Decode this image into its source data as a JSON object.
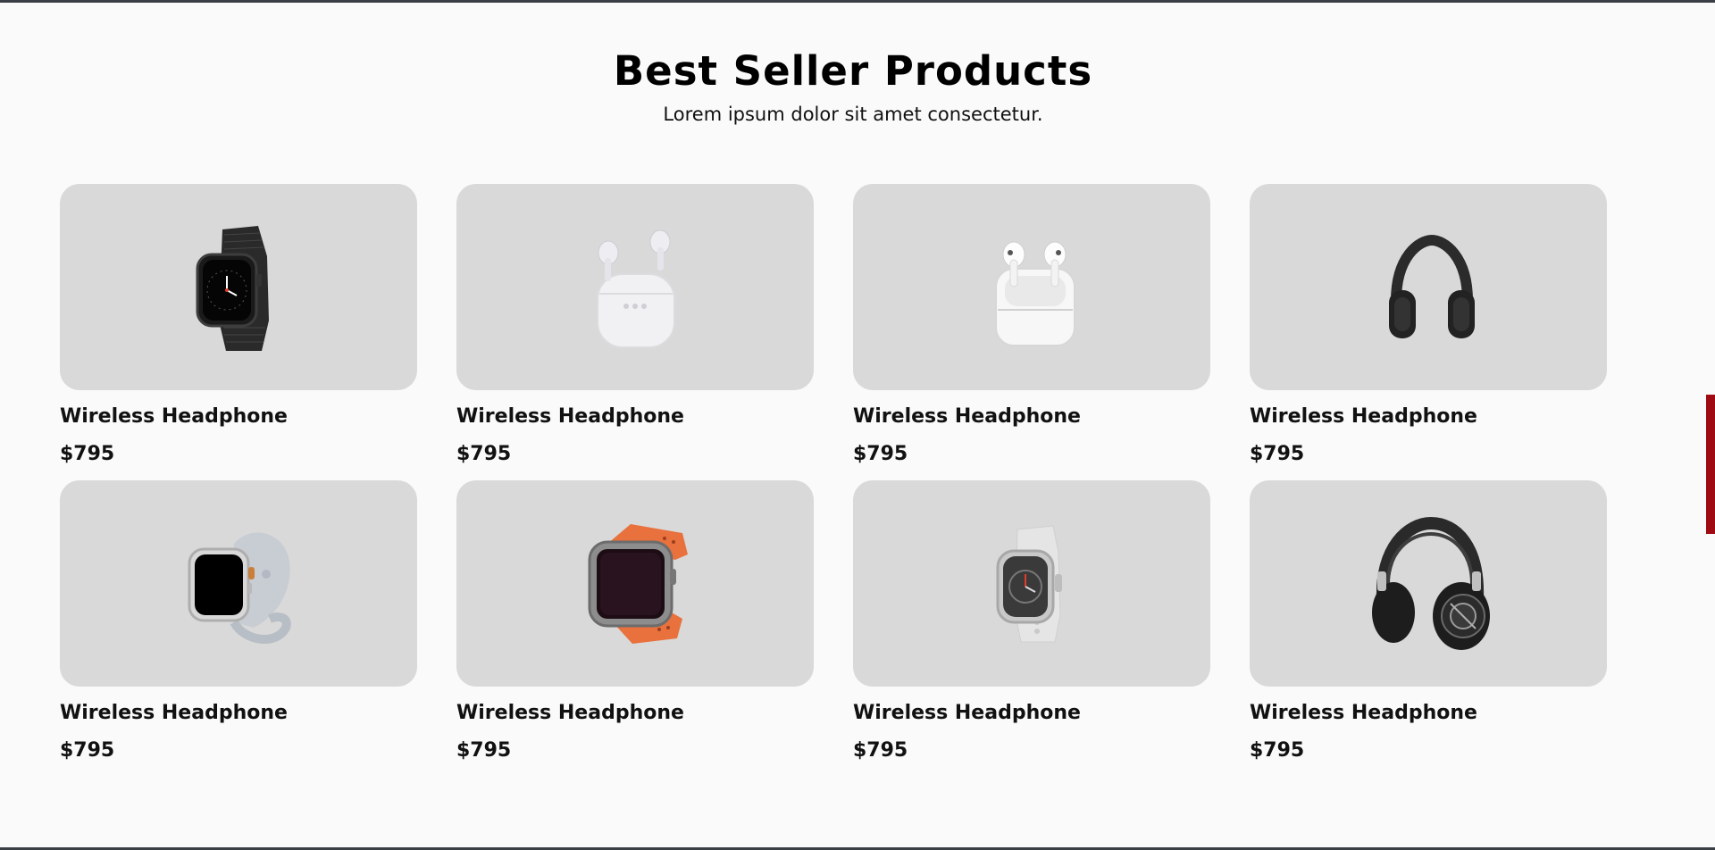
{
  "header": {
    "title": "Best Seller Products",
    "subtitle": "Lorem ipsum dolor sit amet consectetur."
  },
  "colors": {
    "page_background": "#fafafa",
    "card_background": "#d9d9d9",
    "side_tab": "#9e0b13",
    "frame_bar": "#3a3f45"
  },
  "products": [
    {
      "name": "Wireless Headphone",
      "price": "$795",
      "image": "black-mesh-smartwatch-icon"
    },
    {
      "name": "Wireless Headphone",
      "price": "$795",
      "image": "white-earbuds-case-icon"
    },
    {
      "name": "Wireless Headphone",
      "price": "$795",
      "image": "airpods-pro-case-icon"
    },
    {
      "name": "Wireless Headphone",
      "price": "$795",
      "image": "black-headphones-icon"
    },
    {
      "name": "Wireless Headphone",
      "price": "$795",
      "image": "silver-smartwatch-icon"
    },
    {
      "name": "Wireless Headphone",
      "price": "$795",
      "image": "orange-smartwatch-icon"
    },
    {
      "name": "Wireless Headphone",
      "price": "$795",
      "image": "white-sport-watch-icon"
    },
    {
      "name": "Wireless Headphone",
      "price": "$795",
      "image": "large-black-headphones-icon"
    }
  ]
}
